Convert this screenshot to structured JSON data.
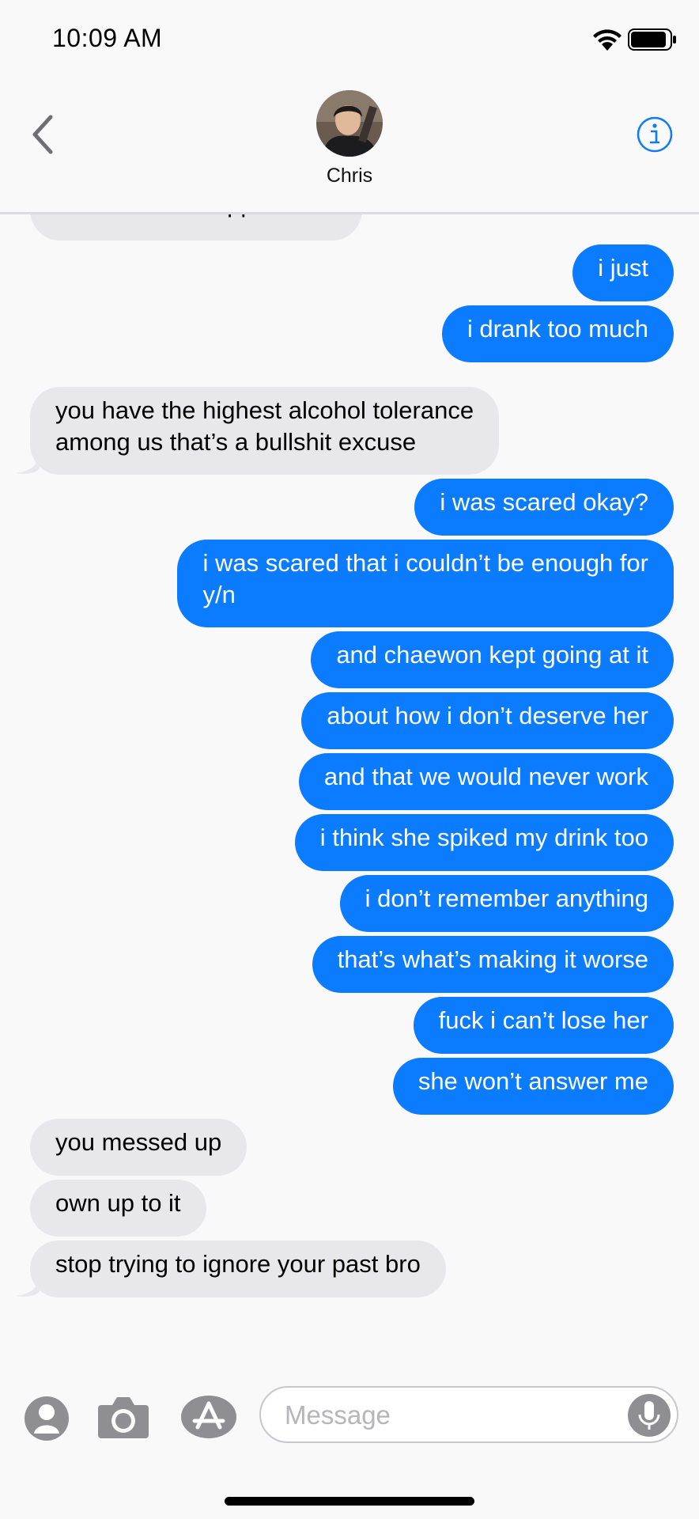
{
  "status_bar": {
    "time": "10:09 AM"
  },
  "header": {
    "contact_name": "Chris"
  },
  "messages": [
    {
      "side": "in",
      "text": "what the hell happened"
    },
    {
      "side": "out",
      "text": "i just"
    },
    {
      "side": "out",
      "text": "i drank too much"
    },
    {
      "side": "in",
      "text": "you have the highest alcohol tolerance\namong us that’s a bullshit excuse"
    },
    {
      "side": "out",
      "text": "i was scared okay?"
    },
    {
      "side": "out",
      "text": "i was scared that i couldn’t be enough for\ny/n"
    },
    {
      "side": "out",
      "text": "and chaewon kept going at it"
    },
    {
      "side": "out",
      "text": "about how i don’t deserve her"
    },
    {
      "side": "out",
      "text": "and that we would never work"
    },
    {
      "side": "out",
      "text": "i think she spiked my drink too"
    },
    {
      "side": "out",
      "text": "i don’t remember anything"
    },
    {
      "side": "out",
      "text": "that’s what’s making it worse"
    },
    {
      "side": "out",
      "text": "fuck i can’t lose her"
    },
    {
      "side": "out",
      "text": "she won’t answer me"
    },
    {
      "side": "in",
      "text": "you messed up"
    },
    {
      "side": "in",
      "text": "own up to it"
    },
    {
      "side": "in",
      "text": "stop trying to ignore your past bro"
    }
  ],
  "input_bar": {
    "placeholder": "Message"
  },
  "colors": {
    "outgoing": "#0b7bff",
    "incoming": "#e8e7ec",
    "accent": "#0b7bff"
  },
  "icons": [
    "back-chevron-icon",
    "info-icon",
    "contacts-icon",
    "camera-icon",
    "app-store-icon",
    "microphone-icon",
    "wifi-icon",
    "battery-icon"
  ]
}
